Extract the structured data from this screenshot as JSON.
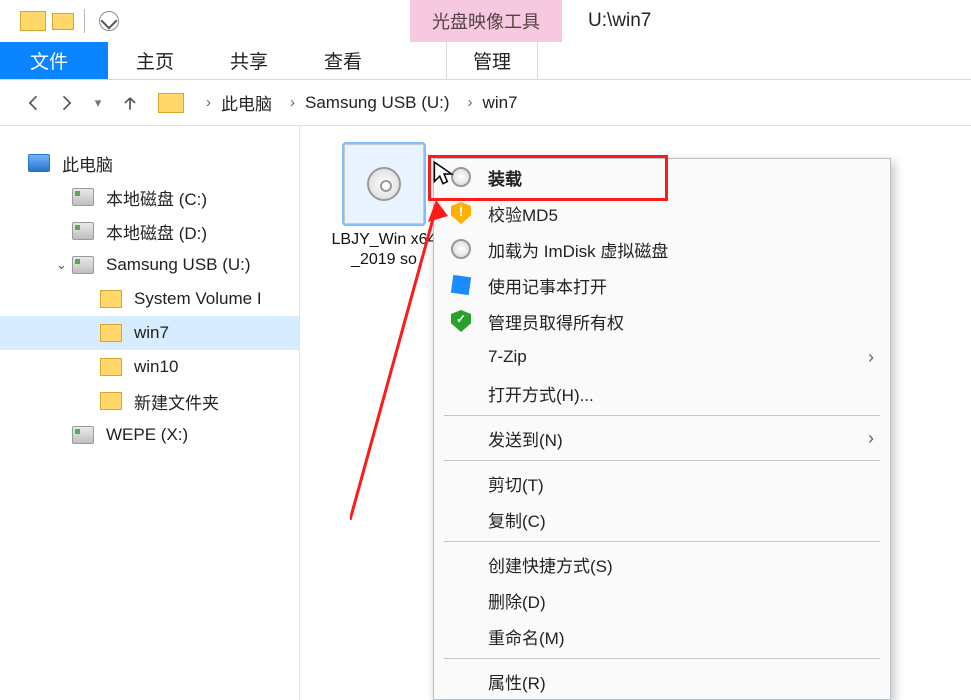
{
  "titlebar": {
    "tool_tab": "光盘映像工具",
    "title": "U:\\win7"
  },
  "ribbon": {
    "file": "文件",
    "tabs": [
      "主页",
      "共享",
      "查看"
    ],
    "manage": "管理"
  },
  "breadcrumbs": [
    "此电脑",
    "Samsung USB (U:)",
    "win7"
  ],
  "tree": {
    "root": "此电脑",
    "drives": [
      {
        "label": "本地磁盘 (C:)",
        "type": "drive"
      },
      {
        "label": "本地磁盘 (D:)",
        "type": "drive"
      },
      {
        "label": "Samsung USB (U:)",
        "type": "drive",
        "expanded": true,
        "children": [
          {
            "label": "System Volume I",
            "type": "fold"
          },
          {
            "label": "win7",
            "type": "fold",
            "selected": true
          },
          {
            "label": "win10",
            "type": "fold"
          },
          {
            "label": "新建文件夹",
            "type": "fold"
          }
        ]
      },
      {
        "label": "WEPE (X:)",
        "type": "drive"
      }
    ]
  },
  "file": {
    "name": "LBJY_Win x64_2019 so"
  },
  "context_menu": [
    {
      "icon": "disc",
      "label": "装载",
      "highlight": true
    },
    {
      "icon": "shield",
      "label": "校验MD5"
    },
    {
      "icon": "disc",
      "label": "加载为 ImDisk 虚拟磁盘"
    },
    {
      "icon": "cube",
      "label": "使用记事本打开"
    },
    {
      "icon": "shield-green",
      "label": "管理员取得所有权"
    },
    {
      "label": "7-Zip",
      "submenu": true
    },
    {
      "label": "打开方式(H)..."
    },
    {
      "sep": true
    },
    {
      "label": "发送到(N)",
      "submenu": true
    },
    {
      "sep": true
    },
    {
      "label": "剪切(T)"
    },
    {
      "label": "复制(C)"
    },
    {
      "sep": true
    },
    {
      "label": "创建快捷方式(S)"
    },
    {
      "label": "删除(D)"
    },
    {
      "label": "重命名(M)"
    },
    {
      "sep": true
    },
    {
      "label": "属性(R)"
    }
  ]
}
